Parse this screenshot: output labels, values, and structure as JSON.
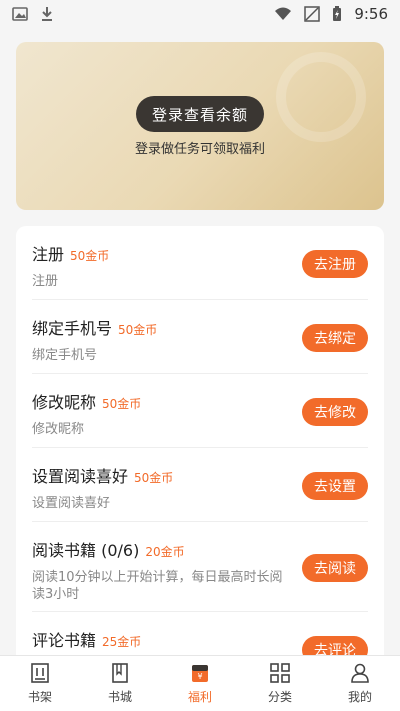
{
  "status_bar": {
    "time": "9:56"
  },
  "banner": {
    "login_button": "登录查看余额",
    "subtitle": "登录做任务可领取福利"
  },
  "tasks": [
    {
      "title": "注册",
      "reward": "50金币",
      "desc": "注册",
      "button": "去注册"
    },
    {
      "title": "绑定手机号",
      "reward": "50金币",
      "desc": "绑定手机号",
      "button": "去绑定"
    },
    {
      "title": "修改昵称",
      "reward": "50金币",
      "desc": "修改昵称",
      "button": "去修改"
    },
    {
      "title": "设置阅读喜好",
      "reward": "50金币",
      "desc": "设置阅读喜好",
      "button": "去设置"
    },
    {
      "title": "阅读书籍 (0/6)",
      "reward": "20金币",
      "desc": "阅读10分钟以上开始计算，每日最高时长阅读3小时",
      "button": "去阅读"
    },
    {
      "title": "评论书籍",
      "reward": "25金币",
      "desc": "",
      "button": "去评论"
    }
  ],
  "tabbar": {
    "items": [
      {
        "label": "书架",
        "icon": "bookshelf-icon",
        "active": false
      },
      {
        "label": "书城",
        "icon": "bookstore-icon",
        "active": false
      },
      {
        "label": "福利",
        "icon": "welfare-icon",
        "active": true
      },
      {
        "label": "分类",
        "icon": "category-icon",
        "active": false
      },
      {
        "label": "我的",
        "icon": "profile-icon",
        "active": false
      }
    ]
  },
  "colors": {
    "accent": "#f26b2a",
    "login_button": "#3a3632",
    "banner": "#ead9b4"
  }
}
